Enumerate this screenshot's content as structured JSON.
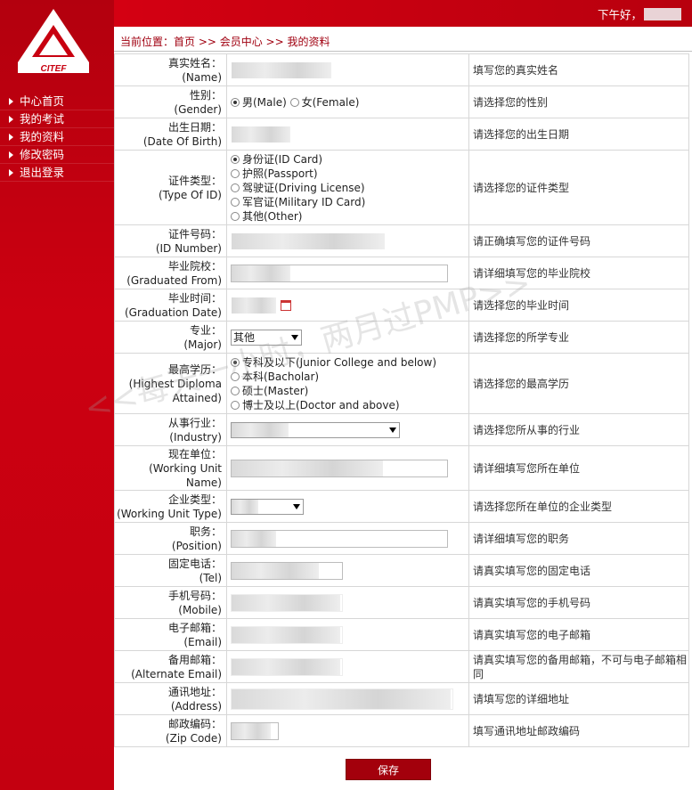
{
  "header": {
    "greeting": "下午好，"
  },
  "logo": {
    "text": "CITEF"
  },
  "sidebar": {
    "items": [
      {
        "label": "中心首页"
      },
      {
        "label": "我的考试"
      },
      {
        "label": "我的资料"
      },
      {
        "label": "修改密码"
      },
      {
        "label": "退出登录"
      }
    ]
  },
  "breadcrumb": {
    "text": "当前位置：首页 >> 会员中心 >> 我的资料"
  },
  "form": {
    "name": {
      "label_cn": "真实姓名：",
      "label_en": "(Name)",
      "hint": "填写您的真实姓名"
    },
    "gender": {
      "label_cn": "性别：",
      "label_en": "(Gender)",
      "hint": "请选择您的性别",
      "options": [
        "男(Male)",
        "女(Female)"
      ],
      "selected": "男(Male)"
    },
    "dob": {
      "label_cn": "出生日期：",
      "label_en": "(Date Of Birth)",
      "hint": "请选择您的出生日期"
    },
    "id_type": {
      "label_cn": "证件类型：",
      "label_en": "(Type Of ID)",
      "hint": "请选择您的证件类型",
      "options": [
        "身份证(ID Card)",
        "护照(Passport)",
        "驾驶证(Driving License)",
        "军官证(Military ID Card)",
        "其他(Other)"
      ],
      "selected": "身份证(ID Card)"
    },
    "id_number": {
      "label_cn": "证件号码：",
      "label_en": "(ID Number)",
      "hint": "请正确填写您的证件号码"
    },
    "graduated": {
      "label_cn": "毕业院校：",
      "label_en": "(Graduated From)",
      "hint": "请详细填写您的毕业院校"
    },
    "grad_date": {
      "label_cn": "毕业时间：",
      "label_en": "(Graduation Date)",
      "hint": "请选择您的毕业时间"
    },
    "major": {
      "label_cn": "专业：",
      "label_en": "(Major)",
      "hint": "请选择您的所学专业",
      "value": "其他"
    },
    "diploma": {
      "label_cn": "最高学历：",
      "label_en": "(Highest Diploma Attained)",
      "hint": "请选择您的最高学历",
      "options": [
        "专科及以下(Junior College and below)",
        "本科(Bacholar)",
        "硕士(Master)",
        "博士及以上(Doctor and above)"
      ],
      "selected": "专科及以下(Junior College and below)"
    },
    "industry": {
      "label_cn": "从事行业：",
      "label_en": "(Industry)",
      "hint": "请选择您所从事的行业"
    },
    "work_unit": {
      "label_cn": "现在单位：",
      "label_en": "(Working Unit Name)",
      "hint": "请详细填写您所在单位"
    },
    "unit_type": {
      "label_cn": "企业类型：",
      "label_en": "(Working Unit Type)",
      "hint": "请选择您所在单位的企业类型"
    },
    "position": {
      "label_cn": "职务：",
      "label_en": "(Position)",
      "hint": "请详细填写您的职务"
    },
    "tel": {
      "label_cn": "固定电话：",
      "label_en": "(Tel)",
      "hint": "请真实填写您的固定电话"
    },
    "mobile": {
      "label_cn": "手机号码：",
      "label_en": "(Mobile)",
      "hint": "请真实填写您的手机号码"
    },
    "email": {
      "label_cn": "电子邮箱：",
      "label_en": "(Email)",
      "hint": "请真实填写您的电子邮箱"
    },
    "alt_email": {
      "label_cn": "备用邮箱：",
      "label_en": "(Alternate Email)",
      "hint": "请真实填写您的备用邮箱，不可与电子邮箱相同"
    },
    "address": {
      "label_cn": "通讯地址：",
      "label_en": "(Address)",
      "hint": "请填写您的详细地址"
    },
    "zip": {
      "label_cn": "邮政编码：",
      "label_en": "(Zip Code)",
      "hint": "填写通讯地址邮政编码"
    }
  },
  "save_label": "保存",
  "watermark": "<<每天一小时，两月过PMP>>",
  "colors": {
    "brand_red": "#c80010",
    "button_red": "#a3000c"
  }
}
